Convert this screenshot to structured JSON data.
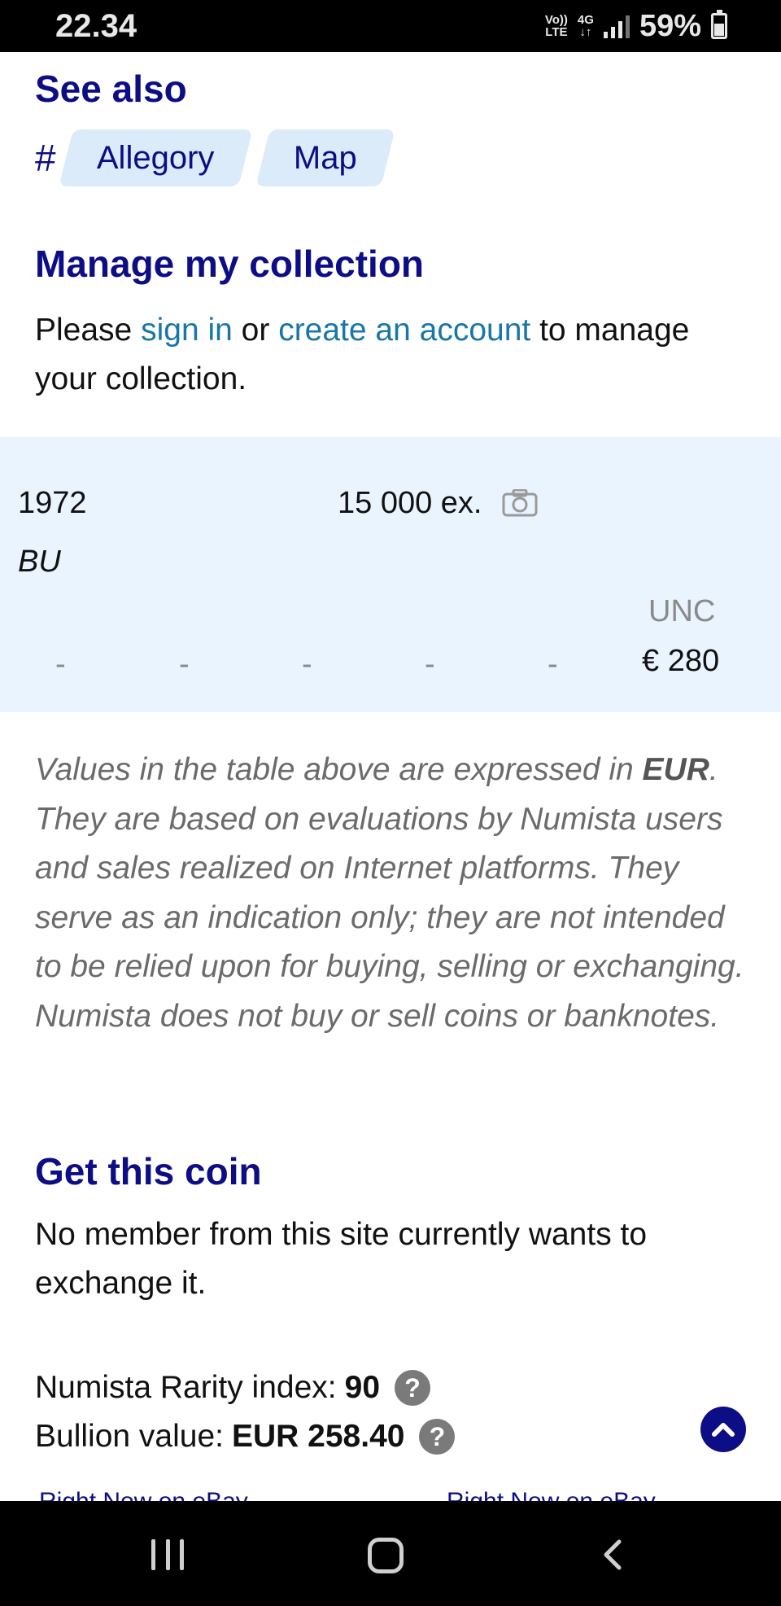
{
  "status_bar": {
    "time": "22.34",
    "volte": "Vo)) LTE",
    "network": "4G",
    "battery_percent": "59%",
    "battery_level": 0.59
  },
  "see_also": {
    "title": "See also",
    "hash": "#",
    "tags": [
      "Allegory",
      "Map"
    ]
  },
  "collection": {
    "title": "Manage my collection",
    "text_before": "Please ",
    "sign_in": "sign in",
    "text_mid": " or ",
    "create_account": "create an account",
    "text_after": " to manage your collection."
  },
  "table": {
    "year": "1972",
    "mintage": "15 000 ex.",
    "type": "BU",
    "grade_header": "UNC",
    "dashes": [
      "-",
      "-",
      "-",
      "-",
      "-"
    ],
    "price": "€ 280",
    "camera_icon": "camera-icon"
  },
  "note": {
    "part1": "Values in the table above are expressed in ",
    "currency": "EUR",
    "part2": ". They are based on evaluations by Numista users and sales realized on Internet platforms. They serve as an indication only; they are not intended to be relied upon for buying, selling or exchanging. Numista does not buy or sell coins or banknotes."
  },
  "get_coin": {
    "title": "Get this coin",
    "text": "No member from this site currently wants to exchange it."
  },
  "rarity": {
    "label": "Numista Rarity index:",
    "value": "90",
    "help": "?"
  },
  "bullion": {
    "label": "Bullion value:",
    "value": "EUR 258.40",
    "help": "?"
  },
  "ebay": {
    "left": "Right Now on eBay",
    "right": "Right Now on eBay"
  },
  "colors": {
    "heading": "#0d0d85",
    "link": "#1876a8",
    "table_bg": "#eaf4fe",
    "tag_bg": "#dcebfa"
  }
}
